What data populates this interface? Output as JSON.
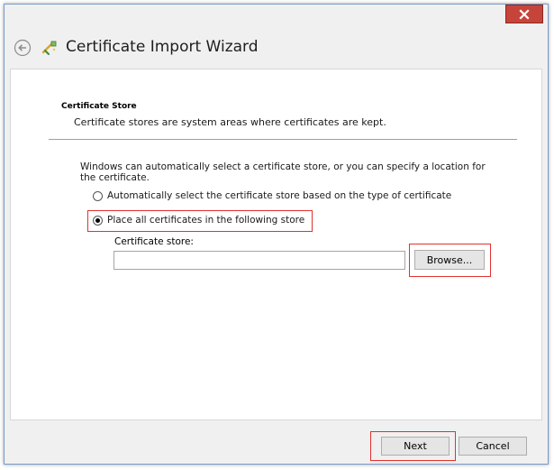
{
  "window": {
    "close_glyph": "✕"
  },
  "header": {
    "title": "Certificate Import Wizard",
    "back_icon": "back-arrow-icon",
    "wizard_icon": "certificate-wizard-icon"
  },
  "content": {
    "section_title": "Certificate Store",
    "section_desc": "Certificate stores are system areas where certificates are kept.",
    "info_text": "Windows can automatically select a certificate store, or you can specify a location for the certificate.",
    "radio_auto_label": "Automatically select the certificate store based on the type of certificate",
    "radio_place_label": "Place all certificates in the following store",
    "store_label": "Certificate store:",
    "store_value": "",
    "browse_label": "Browse..."
  },
  "footer": {
    "next_label": "Next",
    "cancel_label": "Cancel"
  },
  "colors": {
    "highlight": "#e0322e",
    "close_button": "#c7443a"
  }
}
